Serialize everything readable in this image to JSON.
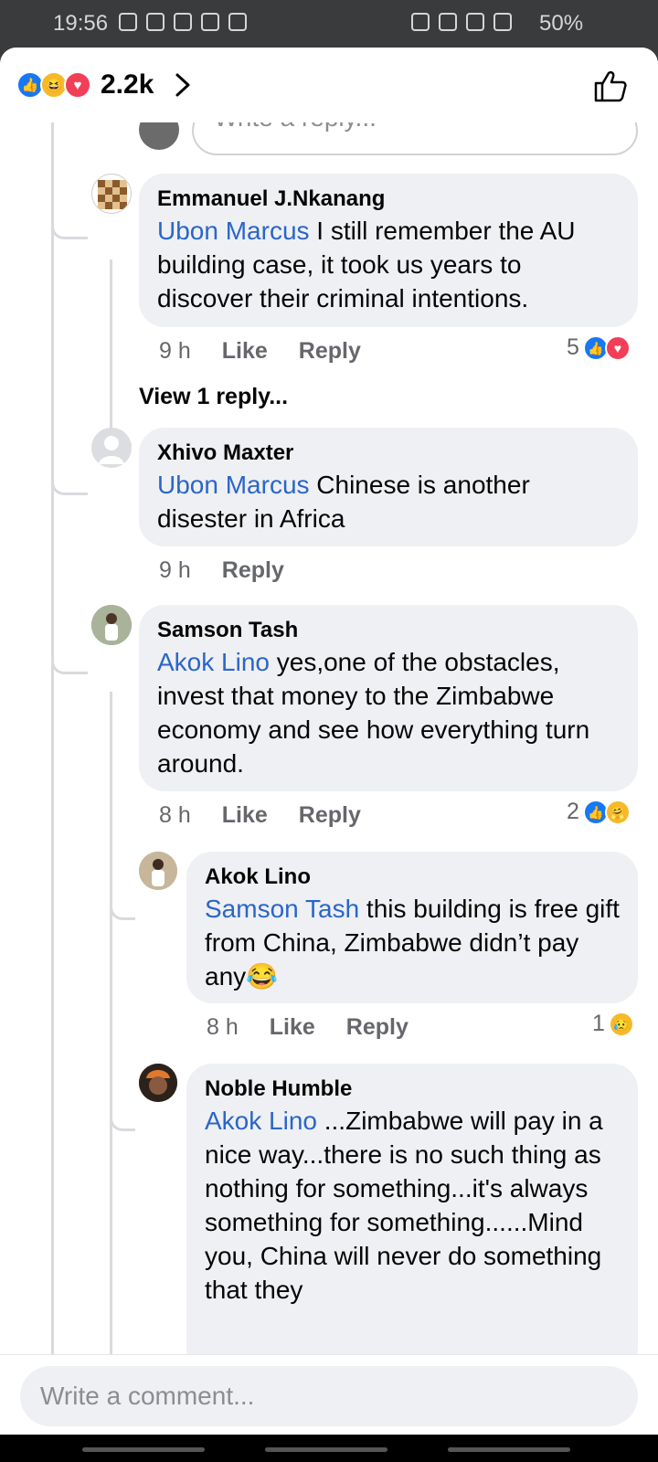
{
  "status_bar": {
    "time": "19:56",
    "battery": "50%"
  },
  "header": {
    "reaction_count": "2.2k"
  },
  "reply_stub": {
    "placeholder": "Write a reply..."
  },
  "comments": [
    {
      "author": "Emmanuel J.Nkanang",
      "mention": "Ubon Marcus",
      "text": " I still remember the AU building case, it took us years to discover their criminal intentions.",
      "time": "9 h",
      "like": "Like",
      "reply": "Reply",
      "reactions": "5",
      "view_replies": "View 1 reply..."
    },
    {
      "author": "Xhivo Maxter",
      "mention": "Ubon Marcus",
      "text": " Chinese is another disester in Africa",
      "time": "9 h",
      "reply": "Reply"
    },
    {
      "author": "Samson Tash",
      "mention": "Akok Lino",
      "text": " yes,one of the obstacles, invest that money to the Zimbabwe economy and see how everything turn around.",
      "time": "8 h",
      "like": "Like",
      "reply": "Reply",
      "reactions": "2"
    },
    {
      "author": "Akok Lino",
      "mention": "Samson Tash",
      "text": " this building is free gift from China, Zimbabwe didn’t pay any",
      "time": "8 h",
      "like": "Like",
      "reply": "Reply",
      "reactions": "1"
    },
    {
      "author": "Noble Humble",
      "mention": "Akok Lino",
      "text": "  ...Zimbabwe will pay in a nice way...there is no such thing as nothing for something...it's always something for something......Mind you, China will never do something that they"
    }
  ],
  "composer": {
    "placeholder": "Write a comment..."
  },
  "colors": {
    "like_blue": "#1877f2",
    "love_red": "#f33e58",
    "mention_blue": "#2a66c9",
    "bubble_gray": "#eff0f3"
  }
}
